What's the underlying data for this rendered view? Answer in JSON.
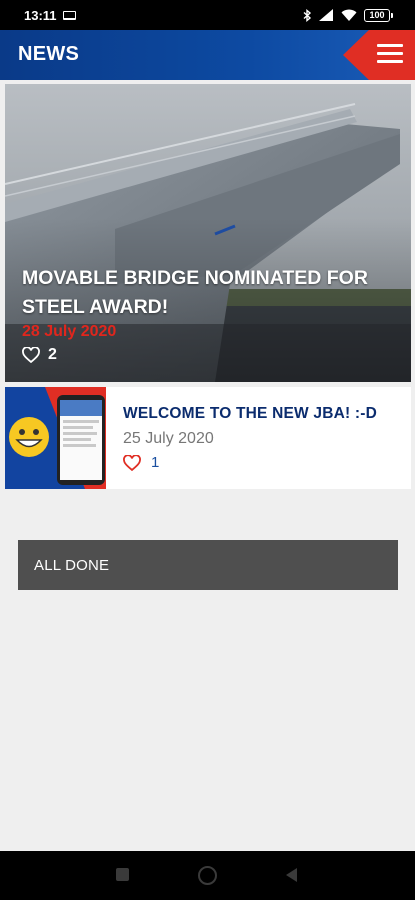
{
  "status_bar": {
    "time": "13:11",
    "battery": "100"
  },
  "header": {
    "title": "NEWS"
  },
  "featured": {
    "title": "MOVABLE BRIDGE NOMINATED FOR STEEL AWARD!",
    "date": "28 July 2020",
    "likes": "2"
  },
  "news_items": [
    {
      "title": "WELCOME TO THE NEW JBA! :-D",
      "date": "25 July 2020",
      "likes": "1"
    }
  ],
  "footer_message": "ALL DONE",
  "colors": {
    "brand_blue": "#0d4aa2",
    "brand_red": "#e02e24",
    "title_blue": "#0b2c6e",
    "date_red": "#e0261d"
  },
  "icons": {
    "menu": "hamburger-icon",
    "like": "heart-outline-icon"
  }
}
